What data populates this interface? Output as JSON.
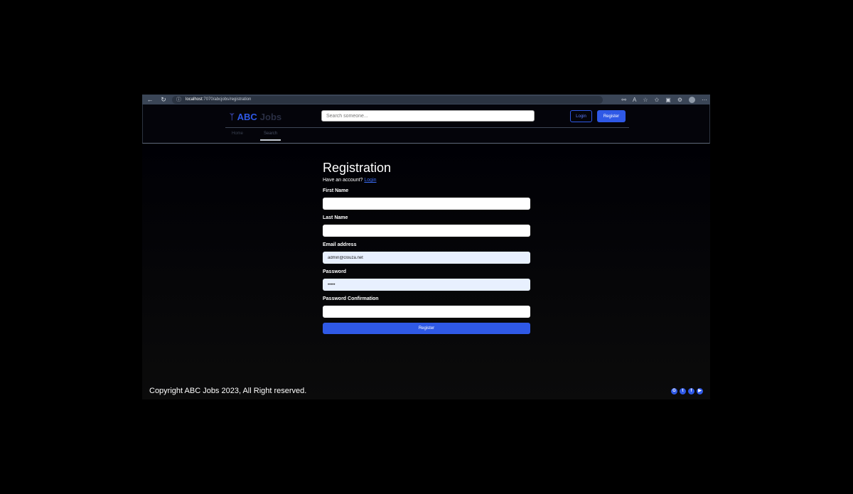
{
  "browser": {
    "url_host": "localhost",
    "url_path": ":7070/abcjobs/registration"
  },
  "header": {
    "brand_first": "ABC",
    "brand_second": "Jobs",
    "search_placeholder": "Search someone...",
    "login_label": "Login",
    "register_label": "Register",
    "tabs": [
      {
        "label": "Home",
        "active": false
      },
      {
        "label": "Search",
        "active": true
      }
    ]
  },
  "form": {
    "title": "Registration",
    "have_account_text": "Have an account?",
    "login_link": "Login",
    "fields": {
      "first_name": {
        "label": "First Name",
        "value": ""
      },
      "last_name": {
        "label": "Last Name",
        "value": ""
      },
      "email": {
        "label": "Email address",
        "value": "admin@clouza.net"
      },
      "password": {
        "label": "Password",
        "value": "•••••"
      },
      "password_confirmation": {
        "label": "Password Confirmation",
        "value": ""
      }
    },
    "submit_label": "Register"
  },
  "footer": {
    "copyright": "Copyright ABC Jobs 2023, All Right reserved.",
    "social_icons": [
      "github-icon",
      "twitter-icon",
      "facebook-icon",
      "youtube-icon"
    ]
  },
  "colors": {
    "accent": "#2f59e6",
    "background": "#000000",
    "browser_chrome": "#3a4556"
  }
}
